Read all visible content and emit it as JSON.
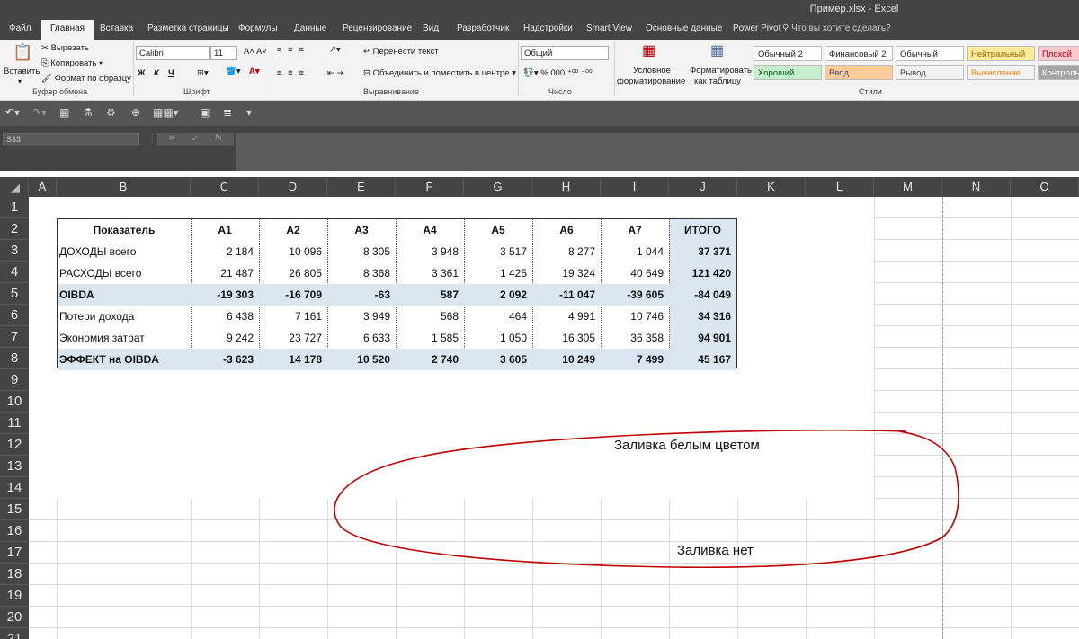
{
  "window": {
    "title": "Пример.xlsx - Excel"
  },
  "tabs": [
    "Файл",
    "Главная",
    "Вставка",
    "Разметка страницы",
    "Формулы",
    "Данные",
    "Рецензирование",
    "Вид",
    "Разработчик",
    "Надстройки",
    "Smart View",
    "Основные данные",
    "Power Pivot"
  ],
  "active_tab": "Главная",
  "search": {
    "placeholder": "Что вы хотите сделать?"
  },
  "ribbon": {
    "clipboard": {
      "paste": "Вставить",
      "cut": "Вырезать",
      "copy": "Копировать",
      "format_painter": "Формат по образцу",
      "group": "Буфер обмена"
    },
    "font": {
      "name": "Calibri",
      "size": "11",
      "bold": "Ж",
      "italic": "К",
      "underline": "Ч",
      "group": "Шрифт"
    },
    "alignment": {
      "wrap": "Перенести текст",
      "merge": "Объединить и поместить в центре",
      "group": "Выравнивание"
    },
    "number": {
      "format": "Общий",
      "group": "Число"
    },
    "styles_group": {
      "conditional_1": "Условное",
      "conditional_2": "форматирование",
      "table_1": "Форматировать",
      "table_2": "как таблицу",
      "group": "Стили"
    },
    "styles": [
      {
        "label": "Обычный 2",
        "bg": "#ffffff",
        "color": "#222222"
      },
      {
        "label": "Финансовый 2",
        "bg": "#ffffff",
        "color": "#222222"
      },
      {
        "label": "Обычный",
        "bg": "#ffffff",
        "color": "#222222"
      },
      {
        "label": "Нейтральный",
        "bg": "#ffeb9c",
        "color": "#9c6500"
      },
      {
        "label": "Плохой",
        "bg": "#ffc7ce",
        "color": "#9c0006"
      },
      {
        "label": "Хороший",
        "bg": "#c6efce",
        "color": "#006100"
      },
      {
        "label": "Ввод",
        "bg": "#ffcc99",
        "color": "#3f3f76"
      },
      {
        "label": "Вывод",
        "bg": "#f2f2f2",
        "color": "#3f3f3f"
      },
      {
        "label": "Вычисление",
        "bg": "#f2f2f2",
        "color": "#fa7d00"
      },
      {
        "label": "Контрольная",
        "bg": "#a5a5a5",
        "color": "#ffffff"
      }
    ]
  },
  "formula_bar": {
    "name_box": "S33",
    "fx": "fx"
  },
  "columns": [
    "A",
    "B",
    "C",
    "D",
    "E",
    "F",
    "G",
    "H",
    "I",
    "J",
    "K",
    "L",
    "M",
    "N",
    "O"
  ],
  "rows": [
    "1",
    "2",
    "3",
    "4",
    "5",
    "6",
    "7",
    "8",
    "9",
    "10",
    "11",
    "12",
    "13",
    "14",
    "15",
    "16",
    "17",
    "18",
    "19",
    "20",
    "21"
  ],
  "table": {
    "headers": [
      "Показатель",
      "A1",
      "A2",
      "A3",
      "A4",
      "A5",
      "A6",
      "A7",
      "ИТОГО"
    ],
    "rows": [
      {
        "label": "ДОХОДЫ всего",
        "values": [
          "2 184",
          "10 096",
          "8 305",
          "3 948",
          "3 517",
          "8 277",
          "1 044",
          "37 371"
        ],
        "bold": false,
        "shaded": false
      },
      {
        "label": "РАСХОДЫ всего",
        "values": [
          "21 487",
          "26 805",
          "8 368",
          "3 361",
          "1 425",
          "19 324",
          "40 649",
          "121 420"
        ],
        "bold": false,
        "shaded": false
      },
      {
        "label": "OIBDA",
        "values": [
          "-19 303",
          "-16 709",
          "-63",
          "587",
          "2 092",
          "-11 047",
          "-39 605",
          "-84 049"
        ],
        "bold": true,
        "shaded": true
      },
      {
        "label": "Потери дохода",
        "values": [
          "6 438",
          "7 161",
          "3 949",
          "568",
          "464",
          "4 991",
          "10 746",
          "34 316"
        ],
        "bold": false,
        "shaded": false
      },
      {
        "label": "Экономия затрат",
        "values": [
          "9 242",
          "23 727",
          "6 633",
          "1 585",
          "1 050",
          "16 305",
          "36 358",
          "94 901"
        ],
        "bold": false,
        "shaded": false
      },
      {
        "label": "ЭФФЕКТ на OIBDA",
        "values": [
          "-3 623",
          "14 178",
          "10 520",
          "2 740",
          "3 605",
          "10 249",
          "7 499",
          "45 167"
        ],
        "bold": true,
        "shaded": true
      }
    ]
  },
  "annotations": {
    "white_fill": "Заливка белым цветом",
    "no_fill": "Заливка нет"
  },
  "colors": {
    "annotation_ellipse": "#c00000",
    "table_shade": "#dce6f1"
  }
}
